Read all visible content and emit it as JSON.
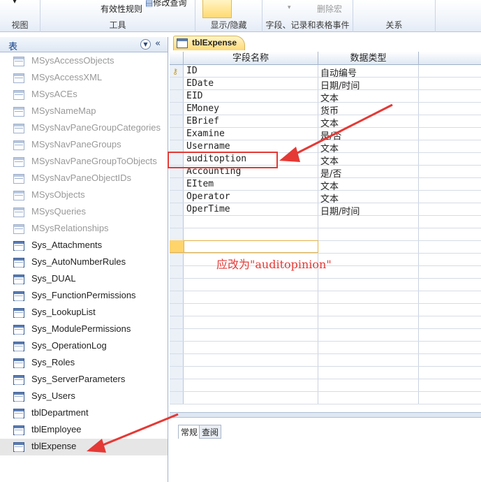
{
  "ribbon": {
    "top_left_label": "视图",
    "rules_label": "有效性规则",
    "modify_query_label": "修改查询",
    "tools_group": "工具",
    "show_hide_group": "显示/隐藏",
    "delete_macro_label": "删除宏",
    "events_group": "字段、记录和表格事件",
    "relations_group": "关系"
  },
  "nav": {
    "header": "表",
    "items": [
      {
        "label": "MSysAccessObjects"
      },
      {
        "label": "MSysAccessXML"
      },
      {
        "label": "MSysACEs"
      },
      {
        "label": "MSysNameMap"
      },
      {
        "label": "MSysNavPaneGroupCategories"
      },
      {
        "label": "MSysNavPaneGroups"
      },
      {
        "label": "MSysNavPaneGroupToObjects"
      },
      {
        "label": "MSysNavPaneObjectIDs"
      },
      {
        "label": "MSysObjects"
      },
      {
        "label": "MSysQueries"
      },
      {
        "label": "MSysRelationships"
      },
      {
        "label": "Sys_Attachments"
      },
      {
        "label": "Sys_AutoNumberRules"
      },
      {
        "label": "Sys_DUAL"
      },
      {
        "label": "Sys_FunctionPermissions"
      },
      {
        "label": "Sys_LookupList"
      },
      {
        "label": "Sys_ModulePermissions"
      },
      {
        "label": "Sys_OperationLog"
      },
      {
        "label": "Sys_Roles"
      },
      {
        "label": "Sys_ServerParameters"
      },
      {
        "label": "Sys_Users"
      },
      {
        "label": "tblDepartment"
      },
      {
        "label": "tblEmployee"
      },
      {
        "label": "tblExpense"
      }
    ]
  },
  "document": {
    "tab_label": "tblExpense"
  },
  "grid": {
    "col_field_name": "字段名称",
    "col_data_type": "数据类型",
    "rows": [
      {
        "name": "ID",
        "type": "自动编号"
      },
      {
        "name": "EDate",
        "type": "日期/时间"
      },
      {
        "name": "EID",
        "type": "文本"
      },
      {
        "name": "EMoney",
        "type": "货币"
      },
      {
        "name": "EBrief",
        "type": "文本"
      },
      {
        "name": "Examine",
        "type": "是/否"
      },
      {
        "name": "Username",
        "type": "文本"
      },
      {
        "name": "auditoption",
        "type": "文本"
      },
      {
        "name": "Accounting",
        "type": "是/否"
      },
      {
        "name": "EItem",
        "type": "文本"
      },
      {
        "name": "Operator",
        "type": "文本"
      },
      {
        "name": "OperTime",
        "type": "日期/时间"
      }
    ]
  },
  "annotation": {
    "text": "应改为\"auditopinion\"",
    "color": "#e53935"
  },
  "properties": {
    "tab_general": "常规",
    "tab_lookup": "查阅"
  }
}
